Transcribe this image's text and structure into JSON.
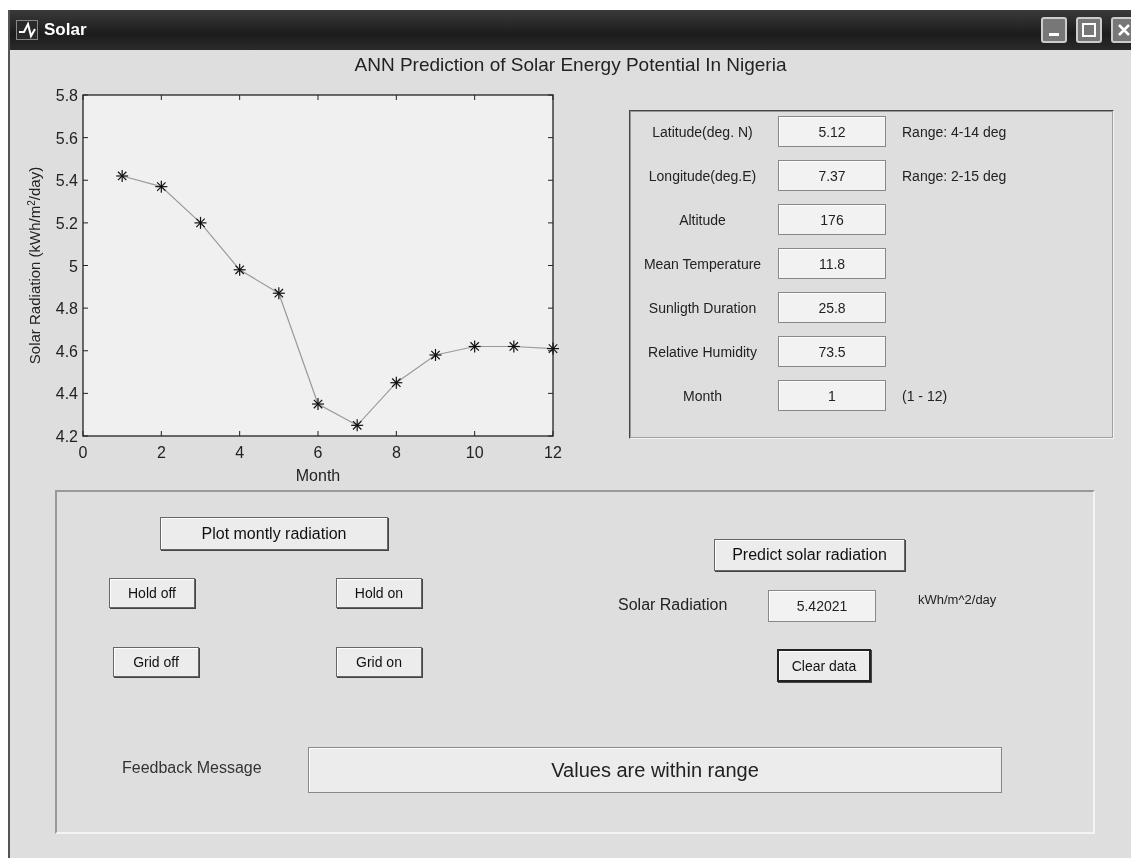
{
  "window": {
    "title": "Solar"
  },
  "heading": "ANN Prediction of Solar Energy Potential In Nigeria",
  "chart": {
    "chart_data": {
      "type": "line",
      "xlabel": "Month",
      "ylabel": "Solar Radiation (kWh/m$^{2}$/day)",
      "x": [
        1,
        2,
        3,
        4,
        5,
        6,
        7,
        8,
        9,
        10,
        11,
        12
      ],
      "series": [
        {
          "color": "#9a9a9a",
          "marker": "cross",
          "values": [
            5.42,
            5.37,
            5.2,
            4.98,
            4.87,
            4.35,
            4.25,
            4.45,
            4.58,
            4.62,
            4.62,
            4.61
          ]
        }
      ],
      "xlim": [
        0,
        12
      ],
      "ylim": [
        4.2,
        5.8
      ],
      "xticks": [
        0,
        2,
        4,
        6,
        8,
        10,
        12
      ],
      "yticks": [
        4.2,
        4.4,
        4.6,
        4.8,
        5,
        5.2,
        5.4,
        5.6,
        5.8
      ]
    }
  },
  "parameters": [
    {
      "label": "Latitude(deg. N)",
      "value": "5.12",
      "note": "Range: 4-14 deg"
    },
    {
      "label": "Longitude(deg.E)",
      "value": "7.37",
      "note": "Range: 2-15 deg"
    },
    {
      "label": "Altitude",
      "value": "176"
    },
    {
      "label": "Mean Temperature",
      "value": "11.8"
    },
    {
      "label": "Sunligth Duration",
      "value": "25.8"
    },
    {
      "label": "Relative Humidity",
      "value": "73.5"
    },
    {
      "label": "Month",
      "value": "1",
      "note": "(1 - 12)"
    }
  ],
  "plot_button": "Plot montly radiation",
  "hold_buttons": [
    "Hold off",
    "Hold on"
  ],
  "grid_buttons": [
    "Grid off",
    "Grid on"
  ],
  "predict_button": "Predict solar radiation",
  "result": {
    "label": "Solar Radiation",
    "value": "5.42021",
    "unit": "kWh/m^2/day"
  },
  "clear_button": {
    "label": "Clear data",
    "focused": true
  },
  "feedback": {
    "label": "Feedback Message",
    "value": "Values are within range"
  }
}
